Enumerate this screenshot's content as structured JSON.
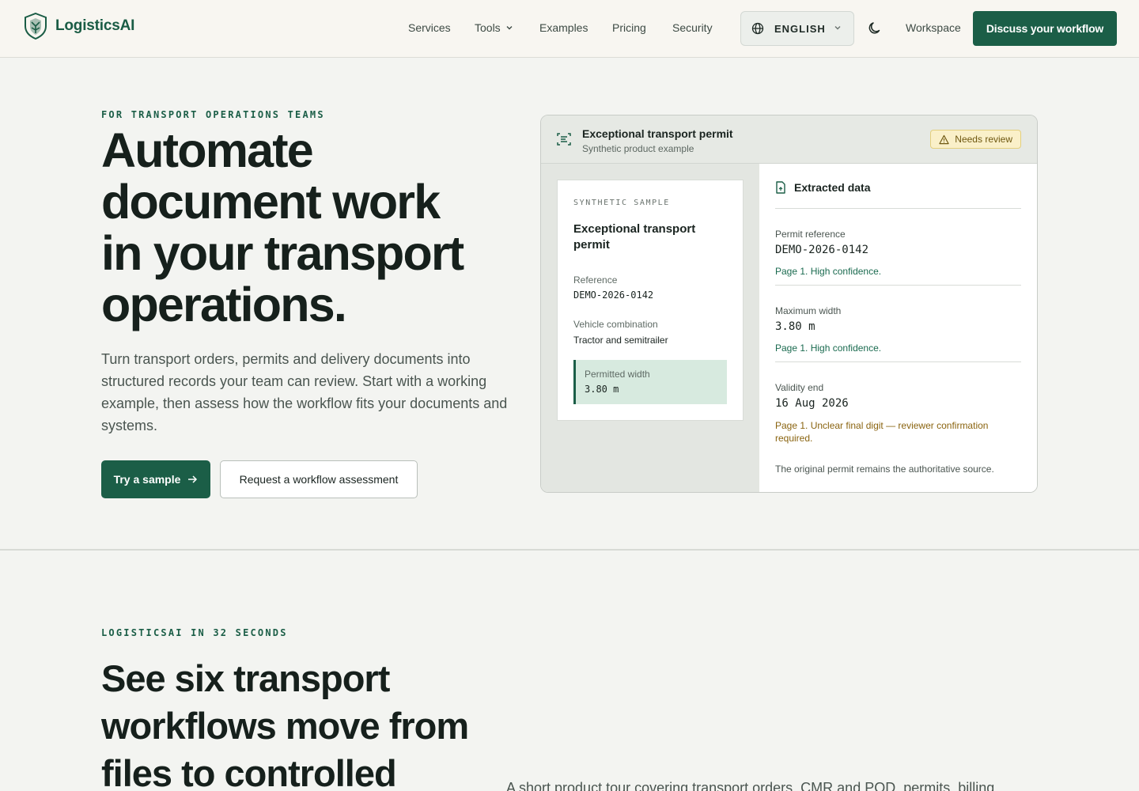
{
  "brand": {
    "name": "LogisticsAI"
  },
  "nav": {
    "services": "Services",
    "tools": "Tools",
    "examples": "Examples",
    "pricing": "Pricing",
    "security": "Security",
    "language": "ENGLISH",
    "workspace": "Workspace",
    "cta": "Discuss your workflow"
  },
  "hero": {
    "eyebrow": "FOR TRANSPORT OPERATIONS TEAMS",
    "title_lines": [
      "Automate",
      "document work",
      "in your transport",
      "operations."
    ],
    "body": "Turn transport orders, permits and delivery documents into structured records your team can review. Start with a working example, then assess how the workflow fits your documents and systems.",
    "primary_button": "Try a sample",
    "secondary_button": "Request a workflow assessment"
  },
  "card": {
    "title": "Exceptional transport permit",
    "subtitle": "Synthetic product example",
    "badge": "Needs review",
    "document": {
      "eyebrow": "SYNTHETIC SAMPLE",
      "title": "Exceptional transport permit",
      "reference_label": "Reference",
      "reference_value": "DEMO-2026-0142",
      "vehicle_label": "Vehicle combination",
      "vehicle_value": "Tractor and semitrailer",
      "width_label": "Permitted width",
      "width_value": "3.80 m"
    },
    "extracted": {
      "title": "Extracted data",
      "fields": [
        {
          "label": "Permit reference",
          "value": "DEMO-2026-0142",
          "note": "Page 1. High confidence."
        },
        {
          "label": "Maximum width",
          "value": "3.80 m",
          "note": "Page 1. High confidence."
        },
        {
          "label": "Validity end",
          "value": "16 Aug 2026",
          "note": "Page 1. Unclear final digit — reviewer confirmation required."
        }
      ],
      "footer": "The original permit remains the authoritative source."
    }
  },
  "section2": {
    "eyebrow": "LOGISTICSAI IN 32 SECONDS",
    "title_lines": [
      "See six transport",
      "workflows move from",
      "files to controlled"
    ],
    "body": "A short product tour covering transport orders, CMR and POD, permits, billing"
  },
  "colors": {
    "brand_green": "#1b5e47",
    "warning_bg": "#faf0c9",
    "warning_text": "#8a6410",
    "confidence_text": "#1b6b50"
  }
}
